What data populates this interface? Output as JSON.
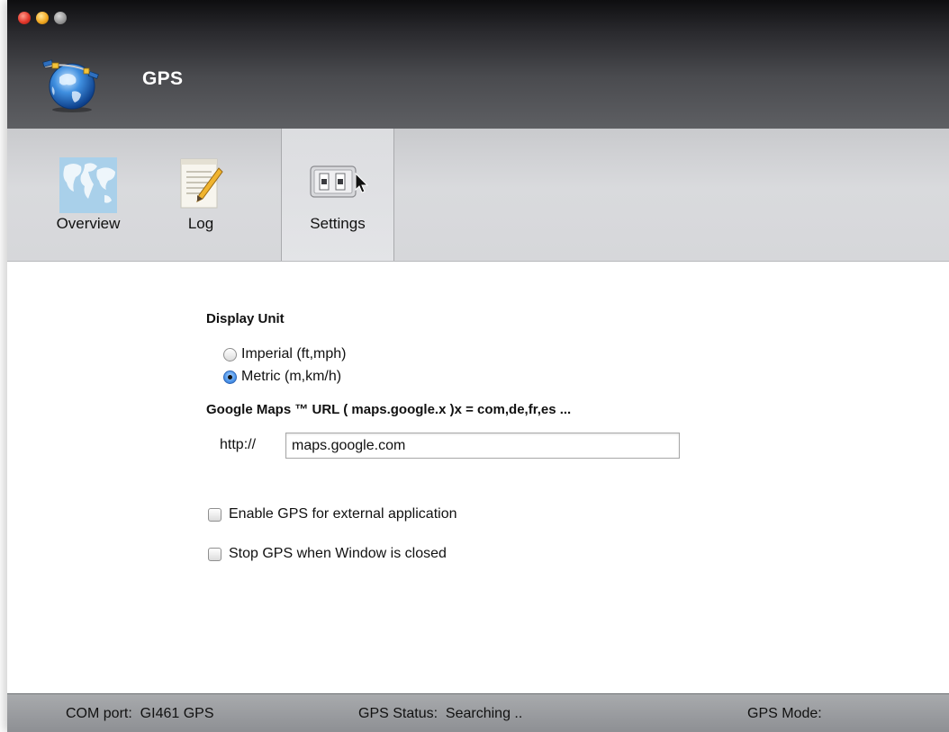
{
  "window": {
    "title": "GPS"
  },
  "toolbar": {
    "items": [
      {
        "label": "Overview",
        "icon": "world-map-icon"
      },
      {
        "label": "Log",
        "icon": "notepad-pencil-icon"
      },
      {
        "label": "Settings",
        "icon": "switches-icon",
        "selected": true
      }
    ]
  },
  "settings": {
    "display_unit": {
      "title": "Display Unit",
      "options": [
        {
          "label": "Imperial (ft,mph)",
          "selected": false
        },
        {
          "label": "Metric (m,km/h)",
          "selected": true
        }
      ]
    },
    "maps_url": {
      "title": "Google Maps ™ URL ( maps.google.x )x = com,de,fr,es ...",
      "prefix": "http://",
      "value": "maps.google.com"
    },
    "checkboxes": [
      {
        "label": "Enable GPS for external application",
        "checked": false
      },
      {
        "label": "Stop GPS when Window is closed",
        "checked": false
      }
    ]
  },
  "status_bar": {
    "com_port": "COM port:  GI461 GPS",
    "gps_status": "GPS Status:  Searching ..",
    "gps_mode": "GPS Mode:"
  },
  "colors": {
    "header_top": "#0e0e10",
    "header_bottom": "#5e5f63",
    "toolbar_bg": "#d9dadd",
    "statusbar_bg": "#9c9ea1",
    "radio_selected": "#4d95ea"
  }
}
